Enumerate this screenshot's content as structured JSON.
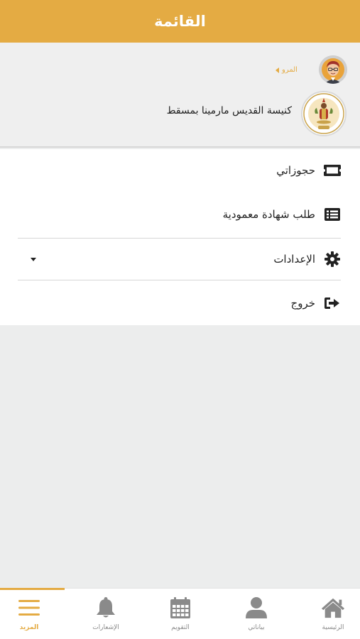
{
  "header": {
    "title": "القائمة"
  },
  "profile": {
    "link_label": "المرو",
    "church_name": "كنيسة القديس مارمينا بمسقط"
  },
  "menu": {
    "items": [
      {
        "label": "حجوزاتي",
        "icon": "ticket-icon"
      },
      {
        "label": "طلب شهادة معمودية",
        "icon": "list-icon"
      },
      {
        "label": "الإعدادات",
        "icon": "gear-icon"
      },
      {
        "label": "خروج",
        "icon": "sign-out-icon"
      }
    ]
  },
  "tabbar": {
    "tabs": [
      {
        "label": "المزيد",
        "icon": "menu-icon",
        "active": true
      },
      {
        "label": "الإشعارات",
        "icon": "bell-icon",
        "active": false
      },
      {
        "label": "التقويم",
        "icon": "calendar-icon",
        "active": false
      },
      {
        "label": "بياناتي",
        "icon": "user-icon",
        "active": false
      },
      {
        "label": "الرئيسية",
        "icon": "home-icon",
        "active": false
      }
    ]
  },
  "colors": {
    "accent": "#e4ab43",
    "inactive": "#8a8a8a",
    "text": "#222222",
    "background": "#eceded"
  }
}
